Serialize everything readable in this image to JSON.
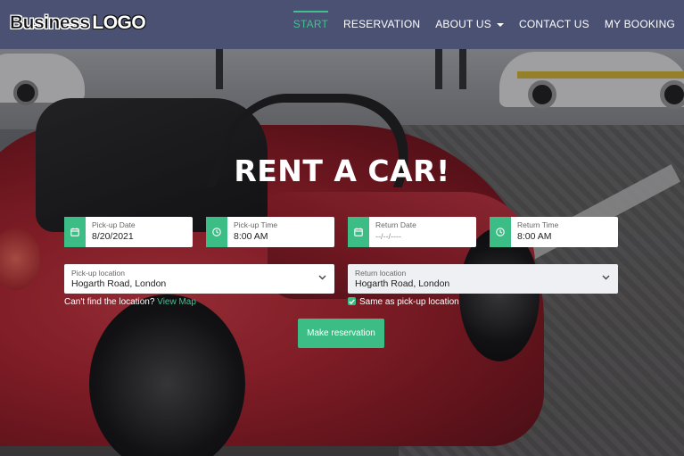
{
  "logo": {
    "part1": "Business",
    "part2": "LOGO"
  },
  "nav": {
    "items": [
      {
        "label": "START",
        "active": true
      },
      {
        "label": "RESERVATION"
      },
      {
        "label": "ABOUT US",
        "dropdown": true
      },
      {
        "label": "CONTACT US"
      },
      {
        "label": "MY BOOKING"
      }
    ]
  },
  "hero": {
    "title": "RENT A CAR!"
  },
  "form": {
    "pickup_date": {
      "label": "Pick-up Date",
      "value": "8/20/2021",
      "icon": "calendar-icon"
    },
    "pickup_time": {
      "label": "Pick-up Time",
      "value": "8:00 AM",
      "icon": "clock-icon"
    },
    "return_date": {
      "label": "Return Date",
      "placeholder": "--/--/----",
      "icon": "calendar-icon"
    },
    "return_time": {
      "label": "Return Time",
      "value": "8:00 AM",
      "icon": "clock-icon"
    },
    "pickup_location": {
      "label": "Pick-up location",
      "value": "Hogarth Road, London"
    },
    "return_location": {
      "label": "Return location",
      "value": "Hogarth Road, London"
    },
    "cant_find": "Can't find the location?",
    "view_map": "View Map",
    "same_as_pickup": "Same as pick-up location",
    "same_as_pickup_checked": true,
    "submit_label": "Make reservation"
  },
  "colors": {
    "accent": "#3dbd86",
    "navbar": "#4a5173"
  }
}
